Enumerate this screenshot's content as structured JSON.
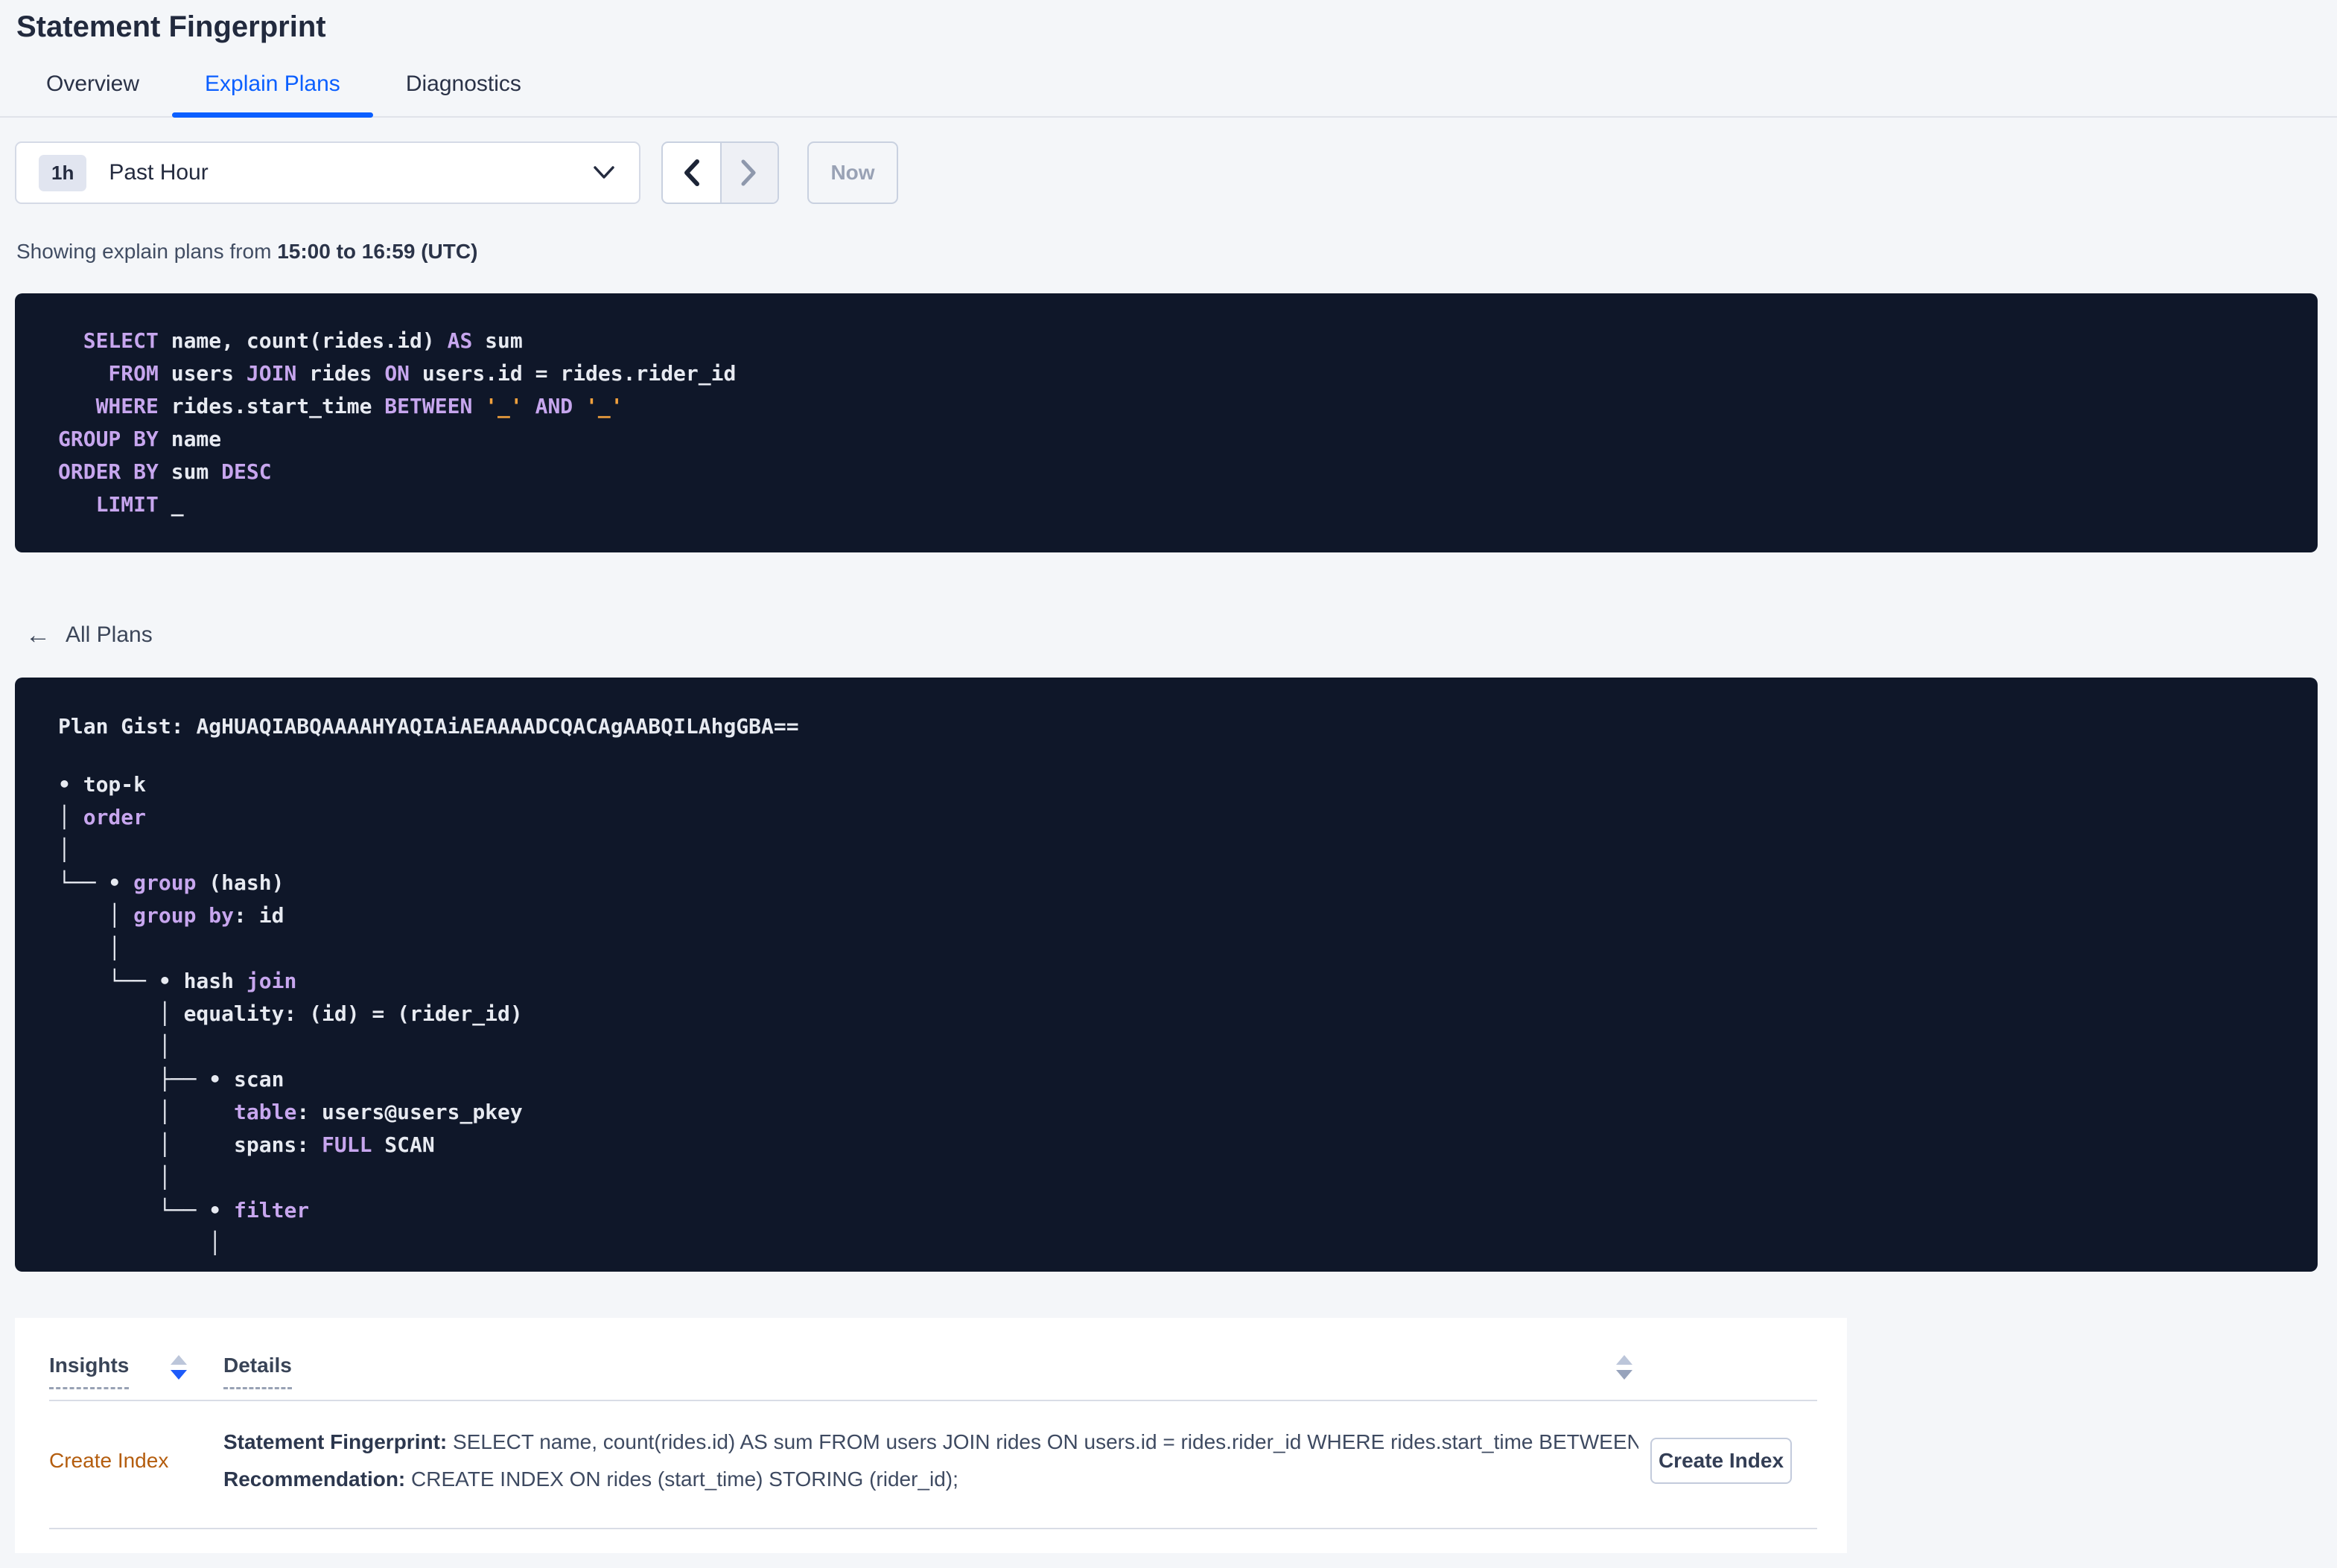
{
  "title": "Statement Fingerprint",
  "tabs": {
    "overview": "Overview",
    "explain_plans": "Explain Plans",
    "diagnostics": "Diagnostics"
  },
  "time_controls": {
    "badge": "1h",
    "selected": "Past Hour",
    "now": "Now"
  },
  "showing": {
    "prefix": "Showing explain plans from ",
    "range": "15:00 to 16:59 (UTC)"
  },
  "sql_lines": [
    [
      [
        "kw",
        "  SELECT"
      ],
      [
        "idn",
        " name, count(rides.id)"
      ],
      [
        "kw",
        " AS"
      ],
      [
        "idn",
        " sum"
      ]
    ],
    [
      [
        "kw",
        "    FROM"
      ],
      [
        "idn",
        " users"
      ],
      [
        "kw",
        " JOIN"
      ],
      [
        "idn",
        " rides"
      ],
      [
        "kw",
        " ON"
      ],
      [
        "idn",
        " users.id = rides.rider_id"
      ]
    ],
    [
      [
        "kw",
        "   WHERE"
      ],
      [
        "idn",
        " rides.start_time"
      ],
      [
        "kw",
        " BETWEEN"
      ],
      [
        "lit",
        " '_'"
      ],
      [
        "kw",
        " AND"
      ],
      [
        "lit",
        " '_'"
      ]
    ],
    [
      [
        "kw",
        "GROUP BY"
      ],
      [
        "idn",
        " name"
      ]
    ],
    [
      [
        "kw",
        "ORDER BY"
      ],
      [
        "idn",
        " sum"
      ],
      [
        "kw",
        " DESC"
      ]
    ],
    [
      [
        "kw",
        "   LIMIT"
      ],
      [
        "idn",
        " _"
      ]
    ]
  ],
  "back_link": "All Plans",
  "plan": {
    "gist_label": "Plan Gist: ",
    "gist": "AgHUAQIABQAAAAHYAQIAiAEAAAADCQACAgAABQILAhgGBA=="
  },
  "tree_lines": [
    [
      [
        "wh",
        "• top-k"
      ]
    ],
    [
      [
        "wh",
        "│ "
      ],
      [
        "pu",
        "order"
      ]
    ],
    [
      [
        "wh",
        "│"
      ]
    ],
    [
      [
        "wh",
        "└── • "
      ],
      [
        "pu",
        "group"
      ],
      [
        "wh",
        " (hash)"
      ]
    ],
    [
      [
        "wh",
        "    │ "
      ],
      [
        "pu",
        "group by"
      ],
      [
        "wh",
        ": id"
      ]
    ],
    [
      [
        "wh",
        "    │"
      ]
    ],
    [
      [
        "wh",
        "    └── • hash "
      ],
      [
        "pu",
        "join"
      ]
    ],
    [
      [
        "wh",
        "        │ equality: (id) = (rider_id)"
      ]
    ],
    [
      [
        "wh",
        "        │"
      ]
    ],
    [
      [
        "wh",
        "        ├── • scan"
      ]
    ],
    [
      [
        "wh",
        "        │     "
      ],
      [
        "pu",
        "table"
      ],
      [
        "wh",
        ": users@users_pkey"
      ]
    ],
    [
      [
        "wh",
        "        │     spans: "
      ],
      [
        "pu",
        "FULL"
      ],
      [
        "wh",
        " SCAN"
      ]
    ],
    [
      [
        "wh",
        "        │"
      ]
    ],
    [
      [
        "wh",
        "        └── • "
      ],
      [
        "pu",
        "filter"
      ]
    ],
    [
      [
        "wh",
        "            │"
      ]
    ]
  ],
  "table": {
    "headers": {
      "insights": "Insights",
      "details": "Details"
    },
    "row": {
      "insight": "Create Index",
      "line1_bold": "Statement Fingerprint:",
      "line1_text": " SELECT name, count(rides.id) AS sum FROM users JOIN rides ON users.id = rides.rider_id WHERE rides.start_time BETWEEN '_…",
      "line2_bold": "Recommendation:",
      "line2_text": " CREATE INDEX ON rides (start_time) STORING (rider_id);",
      "action": "Create Index"
    }
  },
  "colors": {
    "accent_blue": "#0b5fff",
    "code_background": "#0f1729",
    "code_keyword": "#c7a6ee",
    "code_text": "#e7eaf1",
    "code_literal": "#f2a13d",
    "insight_link_orange": "#b45d0e",
    "sort_active_blue": "#1e5bfa",
    "page_background": "#f4f6f9"
  }
}
